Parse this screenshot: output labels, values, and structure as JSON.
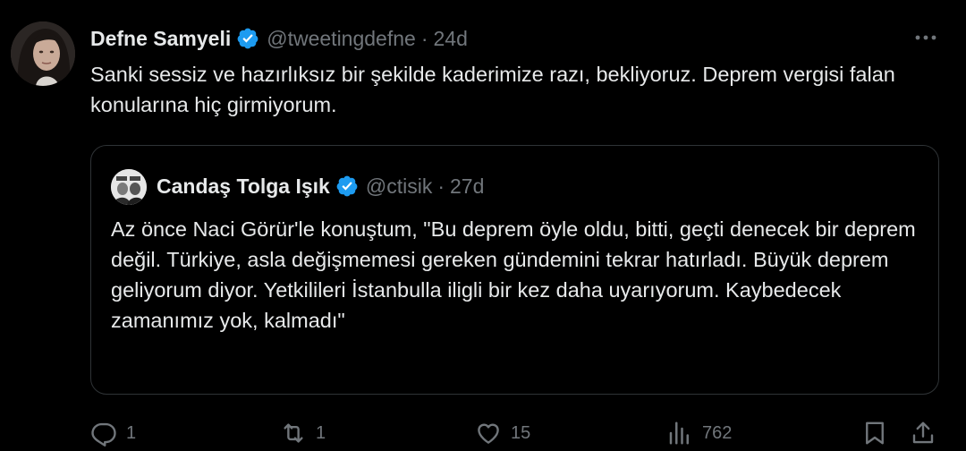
{
  "tweet": {
    "author_name": "Defne Samyeli",
    "handle": "@tweetingdefne",
    "separator": "·",
    "time": "24d",
    "text": "Sanki sessiz ve hazırlıksız bir şekilde kaderimize razı, bekliyoruz. Deprem vergisi falan konularına hiç girmiyorum."
  },
  "quote": {
    "author_name": "Candaş Tolga Işık",
    "handle": "@ctisik",
    "separator": "·",
    "time": "27d",
    "text": "Az önce Naci Görür'le konuştum, \"Bu deprem öyle oldu, bitti, geçti denecek bir deprem değil. Türkiye, asla değişmemesi gereken gündemini tekrar hatırladı. Büyük deprem geliyorum diyor. Yetkilileri İstanbulla iligli bir kez daha uyarıyorum. Kaybedecek zamanımız yok, kalmadı\""
  },
  "actions": {
    "replies": "1",
    "retweets": "1",
    "likes": "15",
    "views": "762"
  },
  "icons": {
    "verified": "verified-badge-icon",
    "more": "more-icon",
    "reply": "reply-icon",
    "retweet": "retweet-icon",
    "like": "heart-icon",
    "views": "views-icon",
    "bookmark": "bookmark-icon",
    "share": "share-icon"
  },
  "colors": {
    "background": "#000000",
    "text": "#e7e9ea",
    "secondary": "#71767b",
    "verified": "#1d9bf0",
    "border": "#2f3336"
  }
}
